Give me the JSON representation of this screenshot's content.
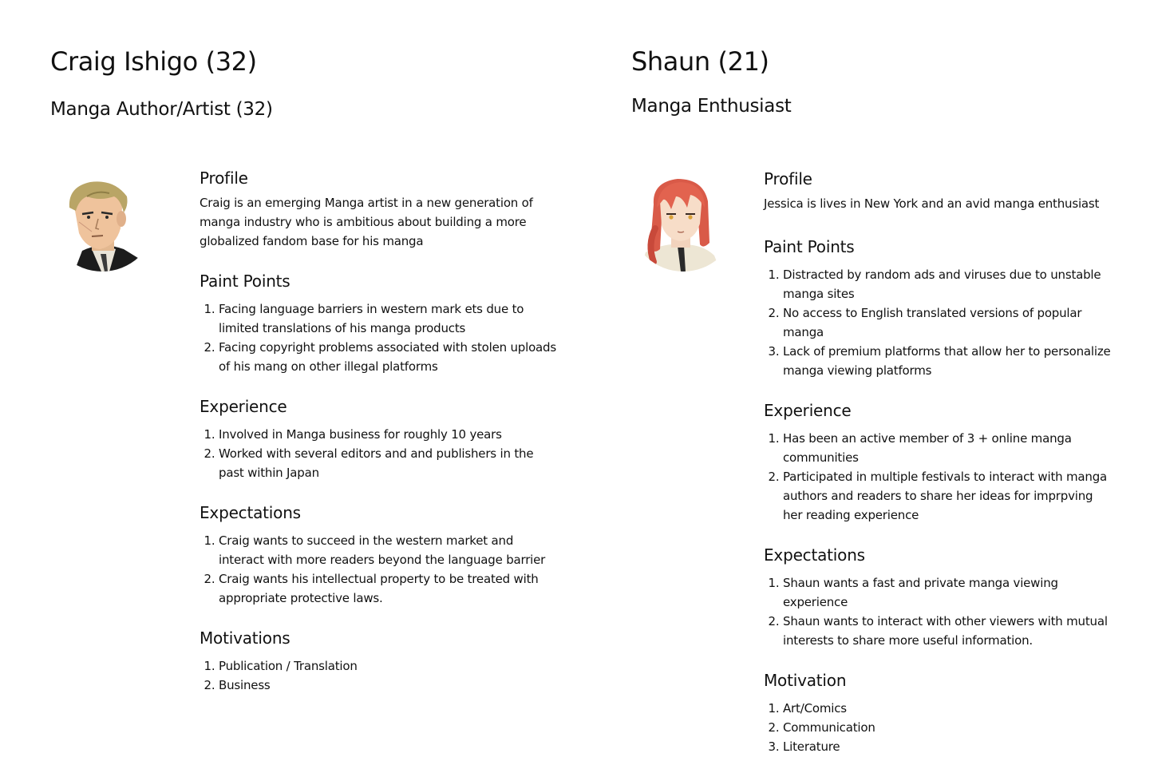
{
  "personas": [
    {
      "name": "Craig Ishigo (32)",
      "role": "Manga Author/Artist (32)",
      "avatar_icon": "man-avatar-icon",
      "profile": {
        "title": "Profile",
        "text": "Craig is an emerging Manga artist in a new generation of manga industry who is ambitious about building a more globalized fandom base for his manga"
      },
      "pain_points": {
        "title": "Paint Points",
        "items": [
          "Facing language barriers in western mark ets due to limited translations of his manga products",
          "Facing copyright problems associated  with stolen uploads of his mang on other illegal platforms"
        ]
      },
      "experience": {
        "title": "Experience",
        "items": [
          "Involved in Manga business for roughly 10 years",
          "Worked with several editors and and publishers in the past within Japan"
        ]
      },
      "expectations": {
        "title": "Expectations",
        "items": [
          "Craig wants to succeed in the western market and interact with more readers beyond the language barrier",
          "Craig wants his intellectual property to be treated with appropriate protective laws."
        ]
      },
      "motivations": {
        "title": "Motivations",
        "items": [
          "Publication / Translation",
          "Business"
        ]
      }
    },
    {
      "name": "Shaun (21)",
      "role": "Manga Enthusiast",
      "avatar_icon": "woman-avatar-icon",
      "profile": {
        "title": "Profile",
        "text": "Jessica is lives in New York and an avid manga enthusiast"
      },
      "pain_points": {
        "title": "Paint Points",
        "items": [
          "Distracted by random ads and viruses due to unstable manga sites",
          "No access to English translated versions of popular manga",
          "Lack of premium platforms that allow her to personalize manga viewing platforms"
        ]
      },
      "experience": {
        "title": "Experience",
        "items": [
          "Has been an active member of 3 + online manga communities",
          "Participated in multiple festivals to interact with manga authors and readers to share her ideas for imprpving her reading experience"
        ]
      },
      "expectations": {
        "title": "Expectations",
        "items": [
          "Shaun wants  a  fast and private manga viewing experience",
          "Shaun wants to interact with other viewers with mutual interests to share more useful information."
        ]
      },
      "motivations": {
        "title": "Motivation",
        "items": [
          "Art/Comics",
          "Communication",
          "Literature"
        ]
      }
    }
  ]
}
